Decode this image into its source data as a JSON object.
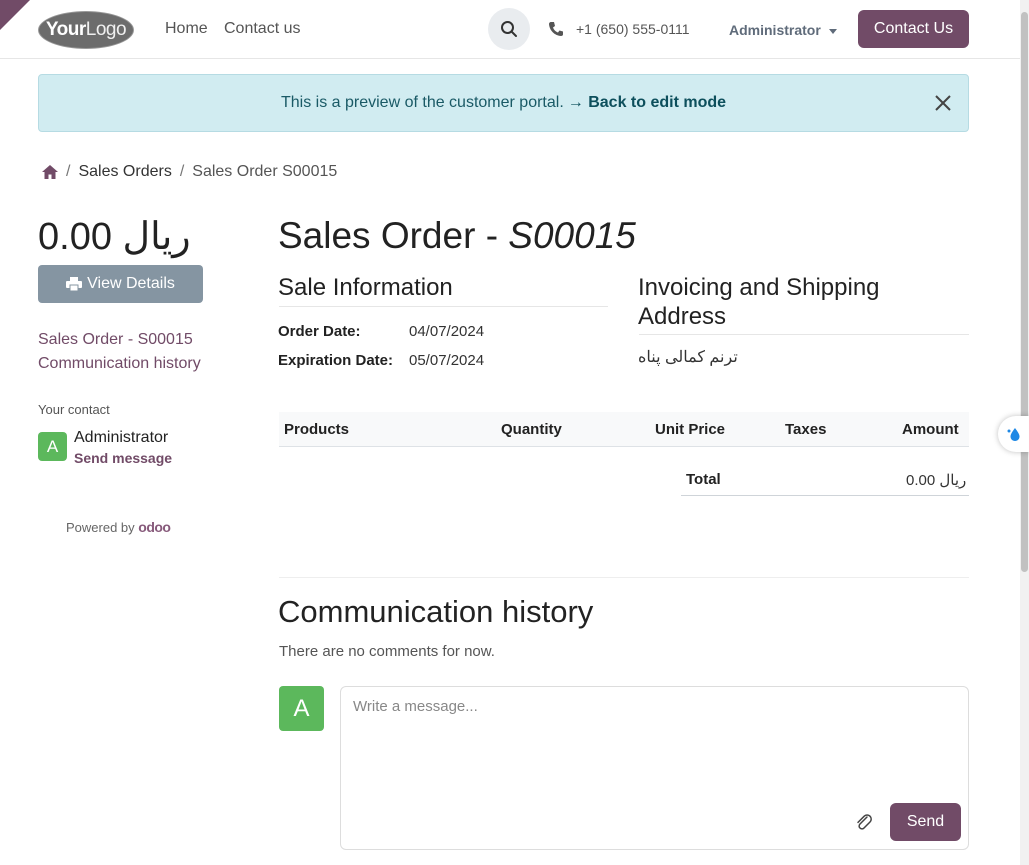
{
  "header": {
    "logo_text_bold": "Your",
    "logo_text_light": "Logo",
    "nav": [
      "Home",
      "Contact us"
    ],
    "phone": "+1 (650) 555-0111",
    "user": "Administrator",
    "contact_button": "Contact Us"
  },
  "alert": {
    "message": "This is a preview of the customer portal.",
    "link": "→ Back to edit mode"
  },
  "breadcrumb": {
    "items": [
      "Sales Orders",
      "Sales Order S00015"
    ]
  },
  "sidebar": {
    "price": "0.00 ریال",
    "view_details": "View Details",
    "links": [
      "Sales Order - S00015",
      "Communication history"
    ],
    "your_contact_label": "Your contact",
    "contact_initial": "A",
    "contact_name": "Administrator",
    "send_message": "Send message",
    "powered_by": "Powered by",
    "powered_brand": "odoo"
  },
  "order": {
    "title_prefix": "Sales Order - ",
    "title_ref": "S00015",
    "sale_info_heading": "Sale Information",
    "order_date_label": "Order Date:",
    "order_date": "04/07/2024",
    "expiration_label": "Expiration Date:",
    "expiration_date": "05/07/2024",
    "address_heading": "Invoicing and Shipping Address",
    "address_name": "ترنم کمالی پناه"
  },
  "table": {
    "columns": [
      "Products",
      "Quantity",
      "Unit Price",
      "Taxes",
      "Amount"
    ],
    "total_label": "Total",
    "total_value": "0.00 ریال"
  },
  "communication": {
    "title": "Communication history",
    "empty_text": "There are no comments for now.",
    "avatar_initial": "A",
    "placeholder": "Write a message...",
    "send": "Send"
  },
  "colors": {
    "brand": "#714B67",
    "alert_bg": "#d1ecf1",
    "avatar_green": "#5cb85c",
    "view_details_bg": "#8595a2"
  }
}
